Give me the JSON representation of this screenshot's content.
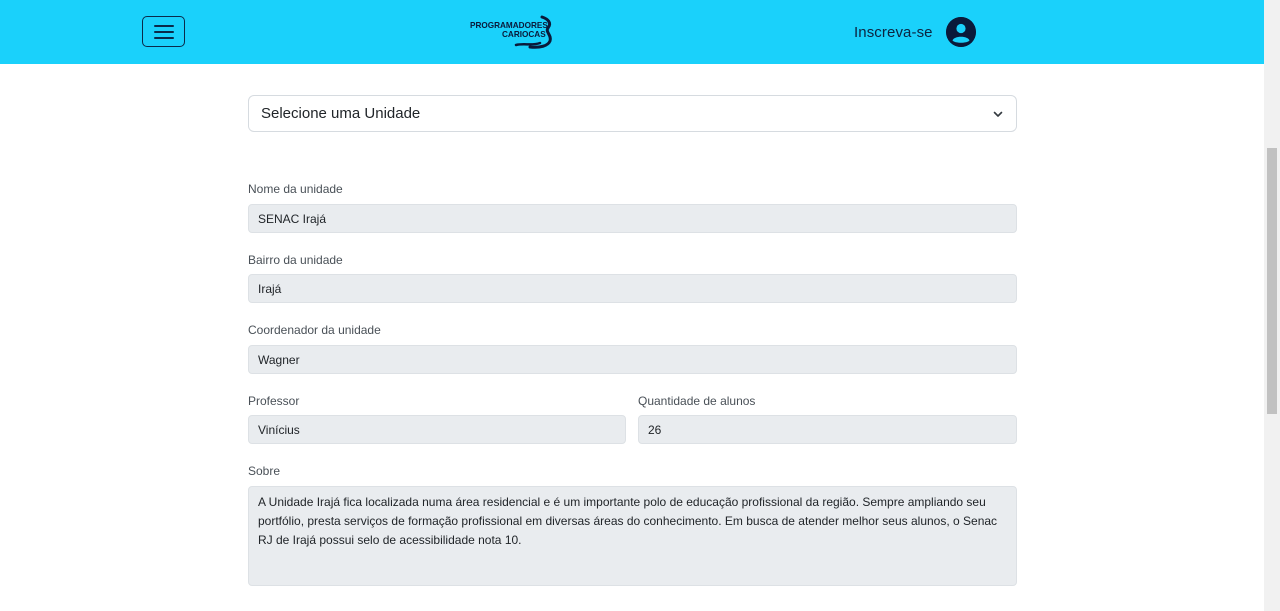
{
  "header": {
    "logo_text_line1": "PROGRAMADORES",
    "logo_text_line2": "CARIOCAS",
    "signup_label": "Inscreva-se",
    "menu_icon": "hamburger-menu-icon",
    "user_icon": "user-circle-icon",
    "bg_color": "#1ad1fb"
  },
  "unit_select": {
    "selected": "Selecione uma Unidade"
  },
  "form": {
    "unit_name_label": "Nome da unidade",
    "unit_name_value": "SENAC Irajá",
    "neighborhood_label": "Bairro da unidade",
    "neighborhood_value": "Irajá",
    "coordinator_label": "Coordenador da unidade",
    "coordinator_value": "Wagner",
    "professor_label": "Professor",
    "professor_value": "Vinícius",
    "students_label": "Quantidade de alunos",
    "students_value": "26",
    "about_label": "Sobre",
    "about_value": "A Unidade Irajá fica localizada numa área residencial e é um importante polo de educação profissional da região. Sempre ampliando seu portfólio, presta serviços de formação profissional em diversas áreas do conhecimento. Em busca de atender melhor seus alunos, o Senac RJ de Irajá possui selo de acessibilidade nota 10."
  }
}
